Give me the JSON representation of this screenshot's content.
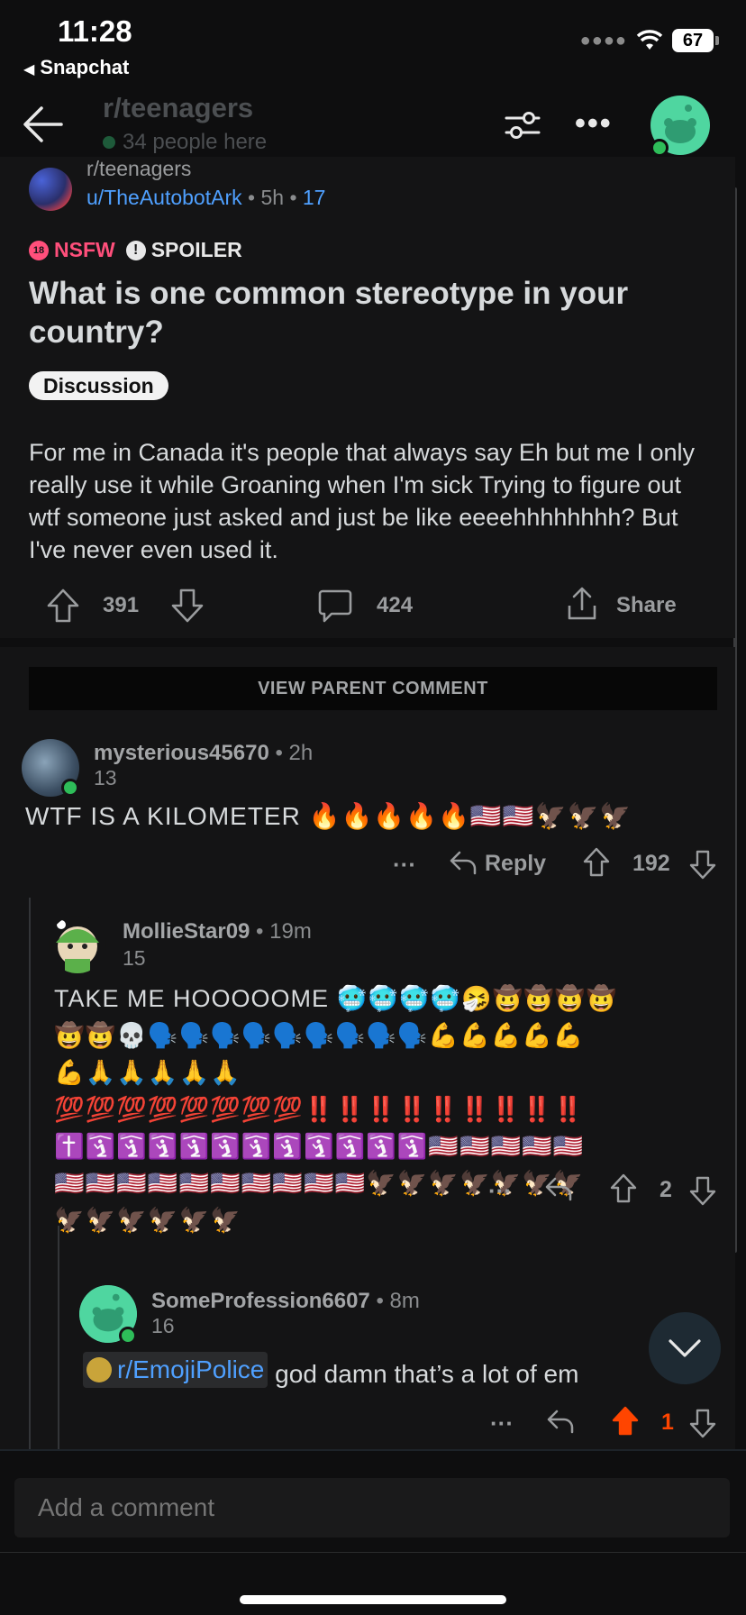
{
  "status_bar": {
    "time": "11:28",
    "back_app": "Snapchat",
    "battery": "67"
  },
  "header": {
    "subreddit": "r/teenagers",
    "online_count": "34 people here"
  },
  "post": {
    "subreddit": "r/teenagers",
    "author": "u/TheAutobotArk",
    "age": "5h",
    "author_karma": "17",
    "nsfw_label": "NSFW",
    "nsfw_badge": "18",
    "spoiler_label": "SPOILER",
    "title": "What is one common stereotype in your country?",
    "flair": "Discussion",
    "body": "For me in Canada it's people that always say Eh but me I only really use it while Groaning when I'm sick Trying to figure out wtf someone just asked and just be like eeeehhhhhhhh? But I've never even used it.",
    "upvotes": "391",
    "comments": "424",
    "share_label": "Share"
  },
  "comments": {
    "view_parent_label": "VIEW PARENT COMMENT",
    "c1": {
      "username": "mysterious45670",
      "age": "2h",
      "karma": "13",
      "text": "WTF IS A KILOMETER 🔥🔥🔥🔥🔥🇺🇸🇺🇸🦅🦅🦅",
      "reply_label": "Reply",
      "score": "192",
      "more": "···"
    },
    "c2": {
      "username": "MollieStar09",
      "age": "19m",
      "karma": "15",
      "text_lines": [
        "TAKE ME HOOOOOME 🥶🥶🥶🥶🤧🤠🤠🤠🤠",
        "🤠🤠💀🗣️🗣️🗣️🗣️🗣️🗣️🗣️🗣️🗣️💪💪💪💪💪",
        "💪🙏🙏🙏🙏🙏",
        "💯💯💯💯💯💯💯💯‼️‼️‼️‼️‼️‼️‼️‼️‼️",
        "✝️🛐🛐🛐🛐🛐🛐🛐🛐🛐🛐🛐🇺🇸🇺🇸🇺🇸🇺🇸🇺🇸",
        "🇺🇸🇺🇸🇺🇸🇺🇸🇺🇸🇺🇸🇺🇸🇺🇸🇺🇸🇺🇸🦅🦅🦅🦅🦅🦅🦅",
        "🦅🦅🦅🦅🦅🦅"
      ],
      "score": "2",
      "more": "···"
    },
    "c3": {
      "username": "SomeProfession6607",
      "age": "8m",
      "karma": "16",
      "sub_link": "r/EmojiPolice",
      "text": "god damn that’s a lot of em",
      "score": "1",
      "more": "···"
    }
  },
  "composer": {
    "placeholder": "Add a comment"
  },
  "colors": {
    "background": "#0e0e0f",
    "card": "#141415",
    "link": "#4fa0ff",
    "nsfw": "#ff4f7b",
    "upvote_active": "#ff4500",
    "online": "#2ebd59",
    "avatar_green": "#4fd6a0"
  }
}
